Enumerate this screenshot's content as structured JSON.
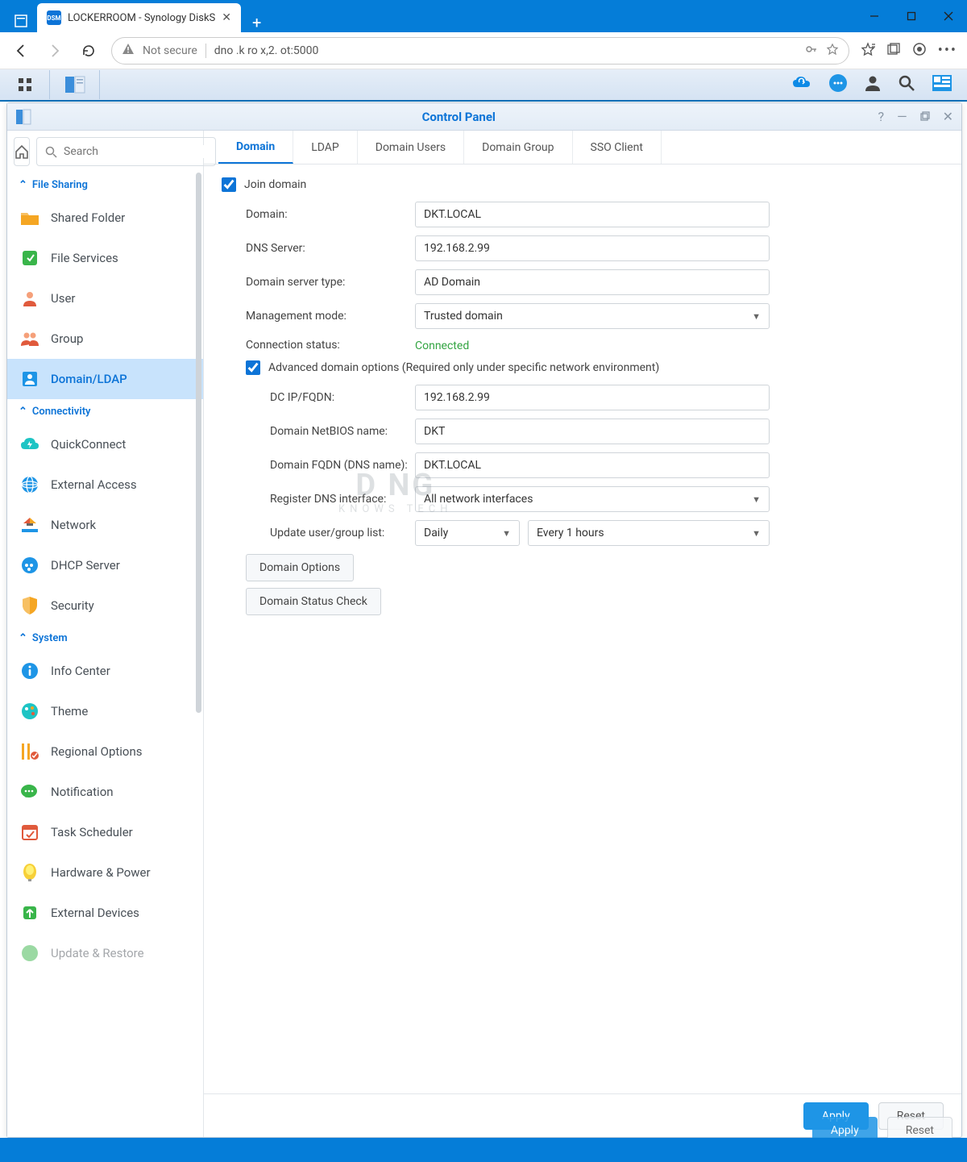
{
  "browser": {
    "tab_title": "LOCKERROOM - Synology DiskS",
    "favicon_text": "DSM",
    "url": "dno .k ro x,2. ot:5000",
    "security_label": "Not secure"
  },
  "window": {
    "title": "Control Panel"
  },
  "sidebar": {
    "search_placeholder": "Search",
    "sections": {
      "file_sharing": "File Sharing",
      "connectivity": "Connectivity",
      "system": "System"
    },
    "items": {
      "shared_folder": "Shared Folder",
      "file_services": "File Services",
      "user": "User",
      "group": "Group",
      "domain_ldap": "Domain/LDAP",
      "quickconnect": "QuickConnect",
      "external_access": "External Access",
      "network": "Network",
      "dhcp_server": "DHCP Server",
      "security": "Security",
      "info_center": "Info Center",
      "theme": "Theme",
      "regional_options": "Regional Options",
      "notification": "Notification",
      "task_scheduler": "Task Scheduler",
      "hardware_power": "Hardware & Power",
      "external_devices": "External Devices",
      "update_restore": "Update & Restore"
    }
  },
  "tabs": {
    "domain": "Domain",
    "ldap": "LDAP",
    "domain_users": "Domain Users",
    "domain_group": "Domain Group",
    "sso_client": "SSO Client"
  },
  "form": {
    "join_domain": "Join domain",
    "domain_label": "Domain:",
    "domain_value": "DKT.LOCAL",
    "dns_label": "DNS Server:",
    "dns_value": "192.168.2.99",
    "server_type_label": "Domain server type:",
    "server_type_value": "AD Domain",
    "mgmt_label": "Management mode:",
    "mgmt_value": "Trusted domain",
    "conn_label": "Connection status:",
    "conn_value": "Connected",
    "adv_label": "Advanced domain options (Required only under specific network environment)",
    "dc_label": "DC IP/FQDN:",
    "dc_value": "192.168.2.99",
    "netbios_label": "Domain NetBIOS name:",
    "netbios_value": "DKT",
    "fqdn_label": "Domain FQDN (DNS name):",
    "fqdn_value": "DKT.LOCAL",
    "dns_iface_label": "Register DNS interface:",
    "dns_iface_value": "All network interfaces",
    "update_list_label": "Update user/group list:",
    "update_freq": "Daily",
    "update_interval": "Every 1 hours",
    "domain_options_btn": "Domain Options",
    "status_check_btn": "Domain Status Check"
  },
  "footer": {
    "apply": "Apply",
    "reset": "Reset"
  },
  "watermark": {
    "l1": "D   NG",
    "l2": "KNOWS TECH"
  }
}
